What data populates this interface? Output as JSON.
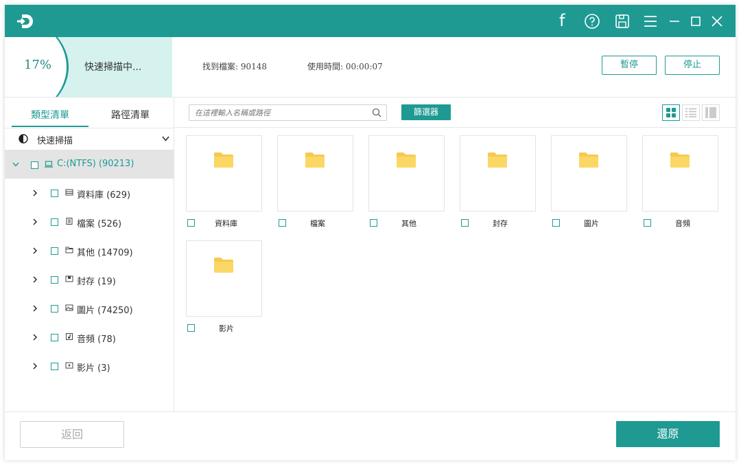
{
  "colors": {
    "accent": "#1e9a93",
    "folder": "#f7c94e",
    "selected_row": "#e4e4e4"
  },
  "titlebar": {
    "icons": [
      "app-logo-icon",
      "facebook-icon",
      "help-icon",
      "save-icon",
      "menu-icon",
      "minimize-icon",
      "maximize-icon",
      "close-icon"
    ],
    "facebook_glyph": "f"
  },
  "scan": {
    "progress_percent": "17%",
    "progress_value": 0.17,
    "status_text": "快速掃描中...",
    "found_text": "找到檔案: 90148",
    "time_text": "使用時間: 00:00:07",
    "pause_label": "暫停",
    "stop_label": "停止"
  },
  "sidebar": {
    "tab_type": "類型清單",
    "tab_path": "路徑清單",
    "quick_scan": "快速掃描",
    "drive": {
      "label": "C:(NTFS) (90213)",
      "icon": "drive-icon"
    },
    "items": [
      {
        "label": "資料庫 (629)",
        "icon": "database-icon"
      },
      {
        "label": "檔案 (526)",
        "icon": "document-icon"
      },
      {
        "label": "其他 (14709)",
        "icon": "folder-icon"
      },
      {
        "label": "封存 (19)",
        "icon": "archive-icon"
      },
      {
        "label": "圖片 (74250)",
        "icon": "image-icon"
      },
      {
        "label": "音頻 (78)",
        "icon": "audio-icon"
      },
      {
        "label": "影片 (3)",
        "icon": "video-icon"
      }
    ]
  },
  "toolbar": {
    "search_placeholder": "在這裡輸入名稱或路徑",
    "filter_label": "篩選器",
    "views": [
      "grid-view-icon",
      "list-view-icon",
      "detail-view-icon"
    ]
  },
  "folders": [
    {
      "label": "資料庫"
    },
    {
      "label": "檔案"
    },
    {
      "label": "其他"
    },
    {
      "label": "封存"
    },
    {
      "label": "圖片"
    },
    {
      "label": "音頻"
    },
    {
      "label": "影片"
    }
  ],
  "footer": {
    "back_label": "返回",
    "recover_label": "還原"
  }
}
